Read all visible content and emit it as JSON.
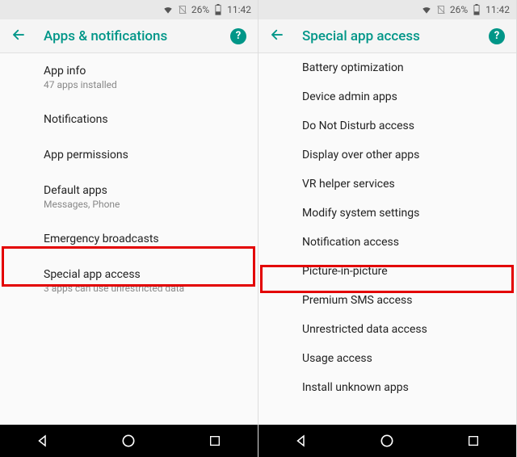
{
  "status": {
    "battery_pct": "26%",
    "time": "11:42"
  },
  "left": {
    "title": "Apps & notifications",
    "items": [
      {
        "label": "App info",
        "sub": "47 apps installed"
      },
      {
        "label": "Notifications",
        "sub": ""
      },
      {
        "label": "App permissions",
        "sub": ""
      },
      {
        "label": "Default apps",
        "sub": "Messages, Phone"
      },
      {
        "label": "Emergency broadcasts",
        "sub": ""
      },
      {
        "label": "Special app access",
        "sub": "3 apps can use unrestricted data"
      }
    ]
  },
  "right": {
    "title": "Special app access",
    "items": [
      {
        "label": "Battery optimization"
      },
      {
        "label": "Device admin apps"
      },
      {
        "label": "Do Not Disturb access"
      },
      {
        "label": "Display over other apps"
      },
      {
        "label": "VR helper services"
      },
      {
        "label": "Modify system settings"
      },
      {
        "label": "Notification access"
      },
      {
        "label": "Picture-in-picture"
      },
      {
        "label": "Premium SMS access"
      },
      {
        "label": "Unrestricted data access"
      },
      {
        "label": "Usage access"
      },
      {
        "label": "Install unknown apps"
      }
    ]
  }
}
